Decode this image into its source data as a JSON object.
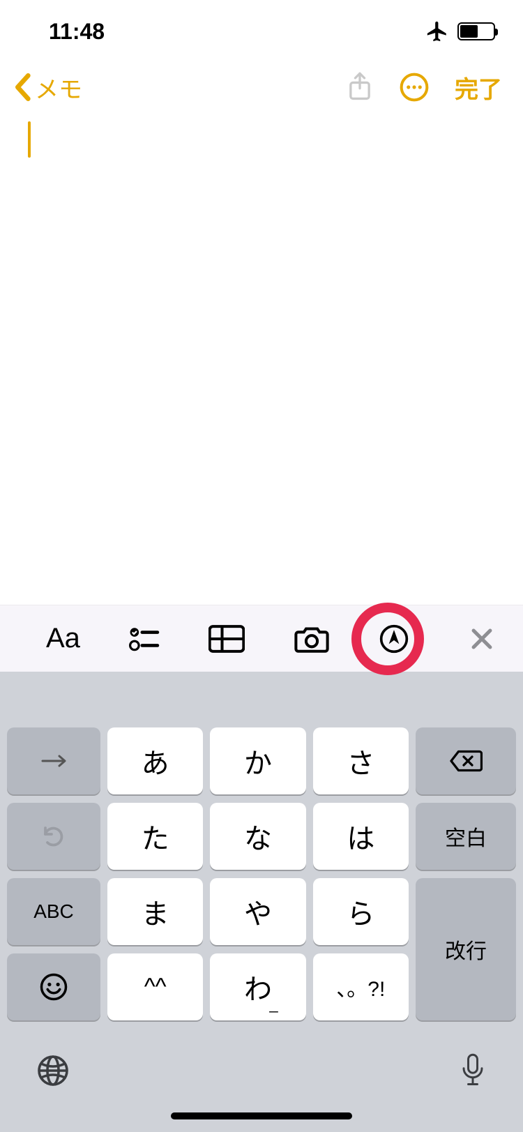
{
  "status": {
    "time": "11:48"
  },
  "nav": {
    "back_label": "メモ",
    "done_label": "完了"
  },
  "editor": {
    "content": ""
  },
  "toolbar": {
    "format_icon_label": "Aa",
    "checklist_icon": "checklist",
    "table_icon": "table",
    "camera_icon": "camera",
    "markup_icon": "markup",
    "close_icon": "close"
  },
  "keyboard": {
    "rows": [
      {
        "left": "→",
        "main": [
          "あ",
          "か",
          "さ"
        ],
        "right": "⌫"
      },
      {
        "left": "↺",
        "main": [
          "た",
          "な",
          "は"
        ],
        "right": "空白"
      },
      {
        "left": "ABC",
        "main": [
          "ま",
          "や",
          "ら"
        ],
        "right_top": ""
      },
      {
        "left": "☺",
        "main": [
          "^^",
          "わ",
          "、。?!"
        ],
        "right": "改行"
      }
    ],
    "row1": {
      "k1": "あ",
      "k2": "か",
      "k3": "さ"
    },
    "row2": {
      "k1": "た",
      "k2": "な",
      "k3": "は"
    },
    "row3": {
      "k1": "ま",
      "k2": "や",
      "k3": "ら"
    },
    "row4": {
      "k1": "^^",
      "k2": "わ",
      "k3": "、。?!"
    },
    "abc": "ABC",
    "space": "空白",
    "return": "改行"
  },
  "colors": {
    "accent": "#e6a800",
    "highlight": "#e6294f"
  }
}
